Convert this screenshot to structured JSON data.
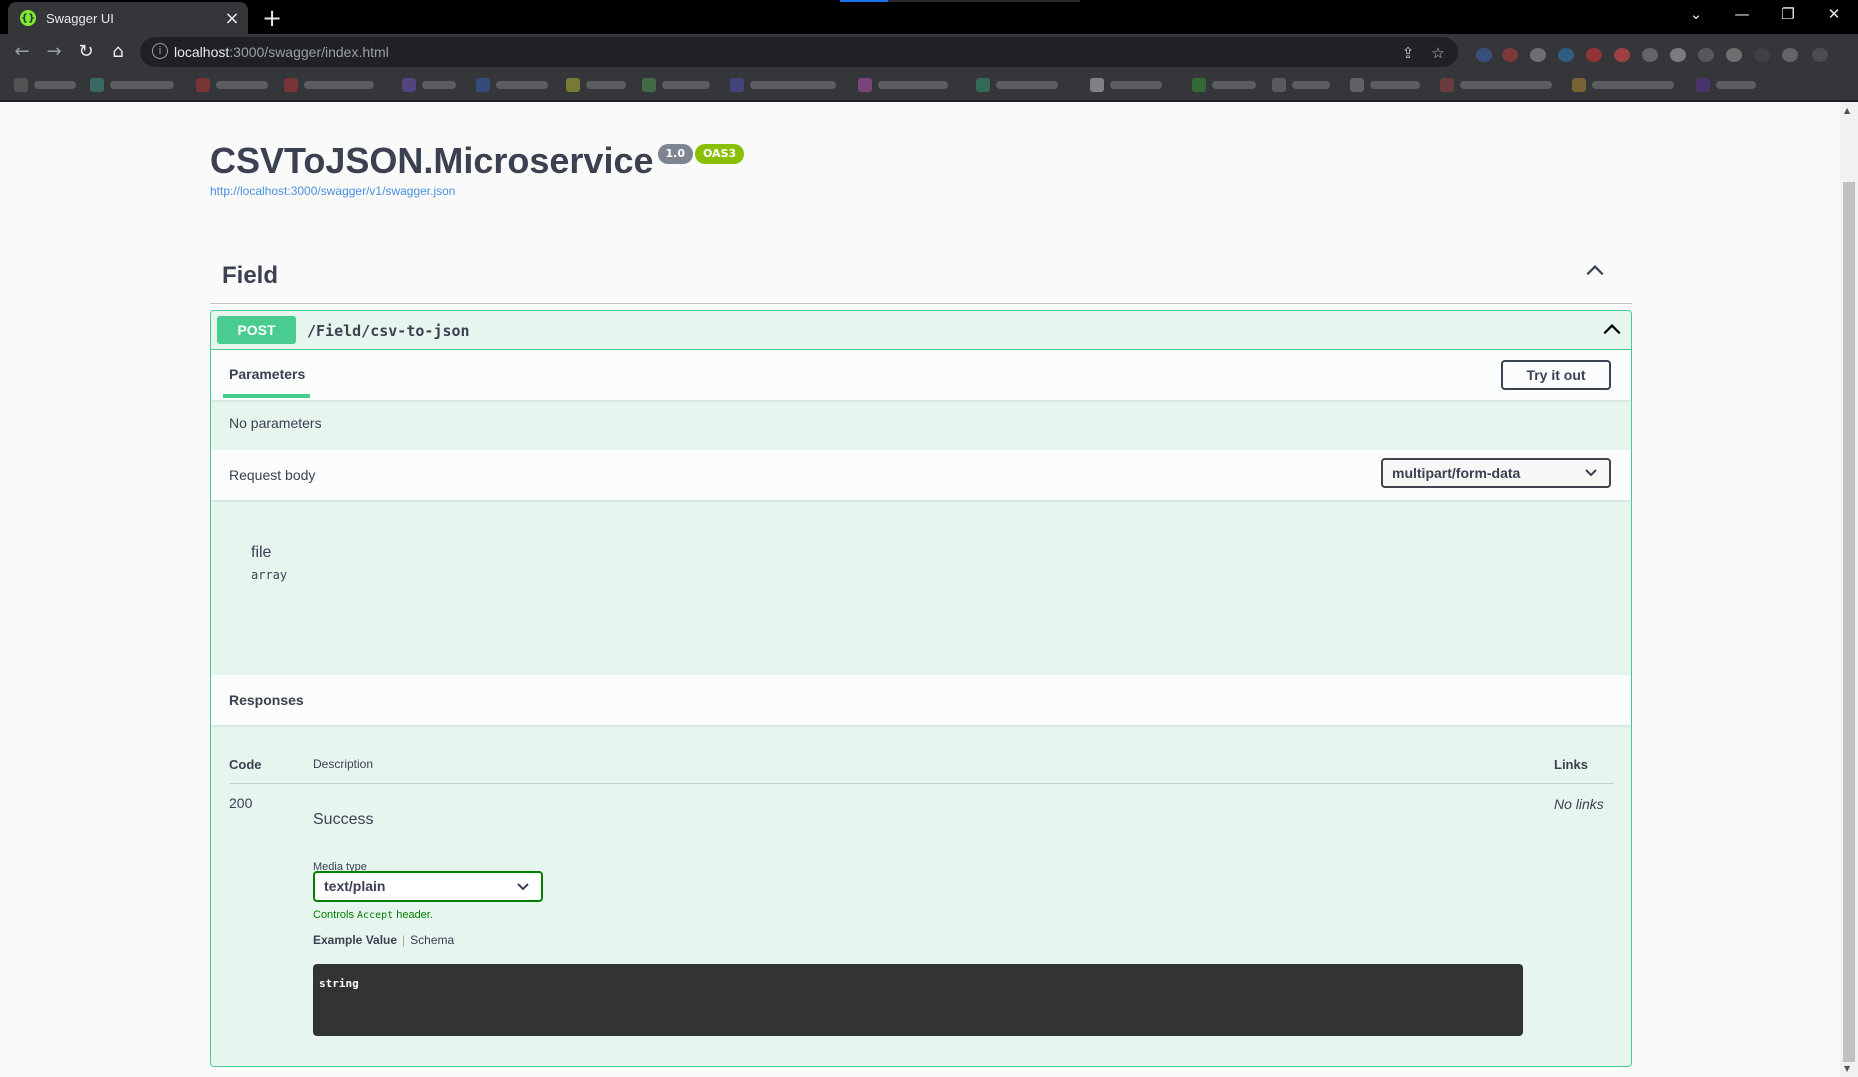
{
  "browser": {
    "tab_title": "Swagger UI",
    "new_tab": "+",
    "url_host": "localhost",
    "url_rest": ":3000/swagger/index.html",
    "favicon_colors": {
      "bg": "#85ea2d"
    }
  },
  "window_controls": {
    "dropdown": "⌄",
    "minimize": "—",
    "restore": "❐",
    "close": "✕"
  },
  "api_info": {
    "title": "CSVToJSON.Microservice",
    "version_badge": "1.0",
    "oas_badge": "OAS3",
    "spec_url": "http://localhost:3000/swagger/v1/swagger.json"
  },
  "tag": {
    "name": "Field"
  },
  "operation": {
    "method": "POST",
    "path": "/Field/csv-to-json",
    "method_color": "#49cc90"
  },
  "parameters": {
    "tab_label": "Parameters",
    "try_button": "Try it out",
    "empty_text": "No parameters"
  },
  "request_body": {
    "label": "Request body",
    "content_type": "multipart/form-data",
    "field_name": "file",
    "field_type": "array"
  },
  "responses": {
    "label": "Responses",
    "columns": {
      "code": "Code",
      "description": "Description",
      "links": "Links"
    },
    "rows": [
      {
        "code": "200",
        "description": "Success",
        "links": "No links",
        "media_type_label": "Media type",
        "media_type": "text/plain",
        "controls_prefix": "Controls ",
        "controls_code": "Accept",
        "controls_suffix": " header.",
        "example_tab": "Example Value",
        "schema_tab": "Schema",
        "example_value": "string"
      }
    ]
  }
}
